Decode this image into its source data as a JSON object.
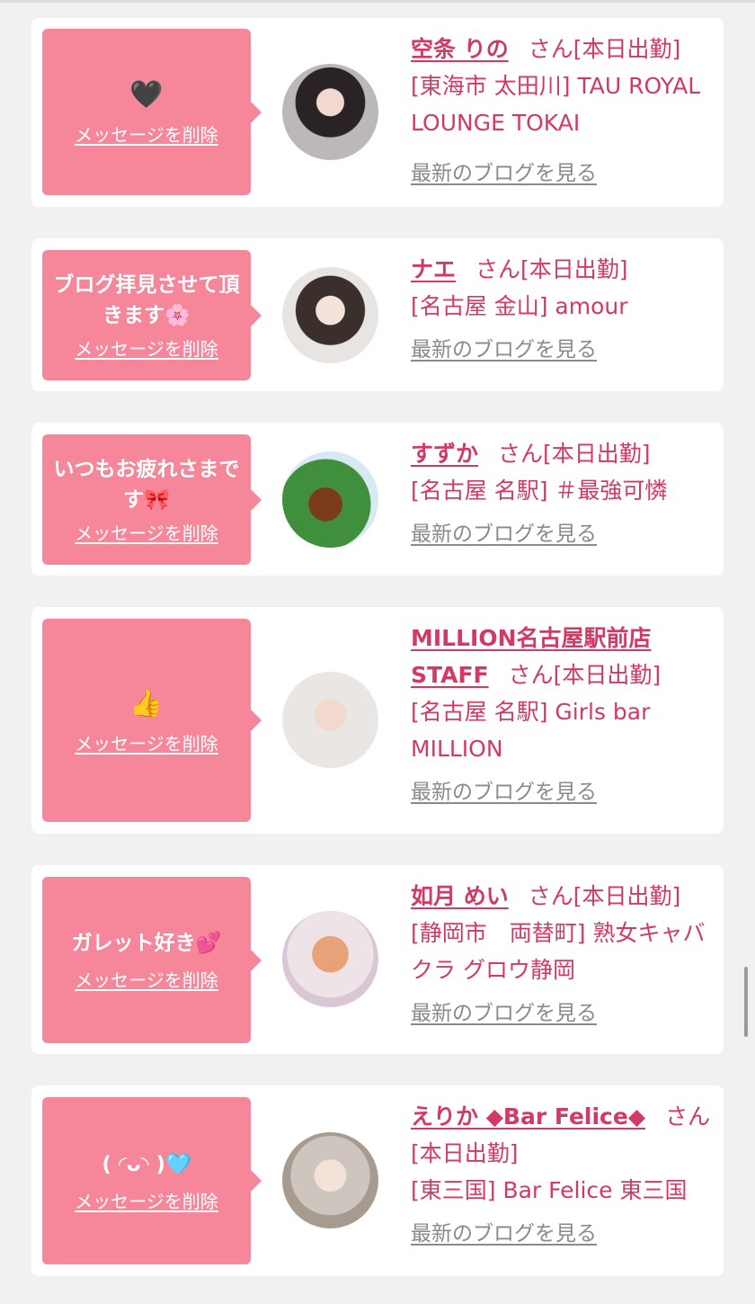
{
  "delete_label": "メッセージを削除",
  "blog_label": "最新のブログを見る",
  "san_label": "さん",
  "work_label": "[本日出勤]",
  "colors": {
    "accent": "#d33a63",
    "bubble": "#f6879a",
    "link_gray": "#8a8a8a"
  },
  "cards": [
    {
      "message": "",
      "emoji": "🖤",
      "name": "空条 りの",
      "location": "[東海市 太田川] TAU ROYAL LOUNGE TOKAI"
    },
    {
      "message": "ブログ拝見させて頂きます🌸",
      "emoji": "",
      "name": "ナエ",
      "location": "[名古屋 金山] amour"
    },
    {
      "message": "いつもお疲れさまです🎀",
      "emoji": "",
      "name": "すずか",
      "location": "[名古屋 名駅] ＃最強可憐"
    },
    {
      "message": "",
      "emoji": "👍",
      "name": "MILLION名古屋駅前店STAFF",
      "location": "[名古屋 名駅] Girls bar MILLION"
    },
    {
      "message": "ガレット好き💕",
      "emoji": "",
      "name": "如月 めい",
      "location": "[静岡市　両替町] 熟女キャバクラ グロウ静岡"
    },
    {
      "message": "( ◜ᴗ◝ )🩵",
      "emoji": "",
      "name": "えりか ◆Bar Felice◆",
      "location": "[東三国] Bar Felice 東三国"
    }
  ]
}
